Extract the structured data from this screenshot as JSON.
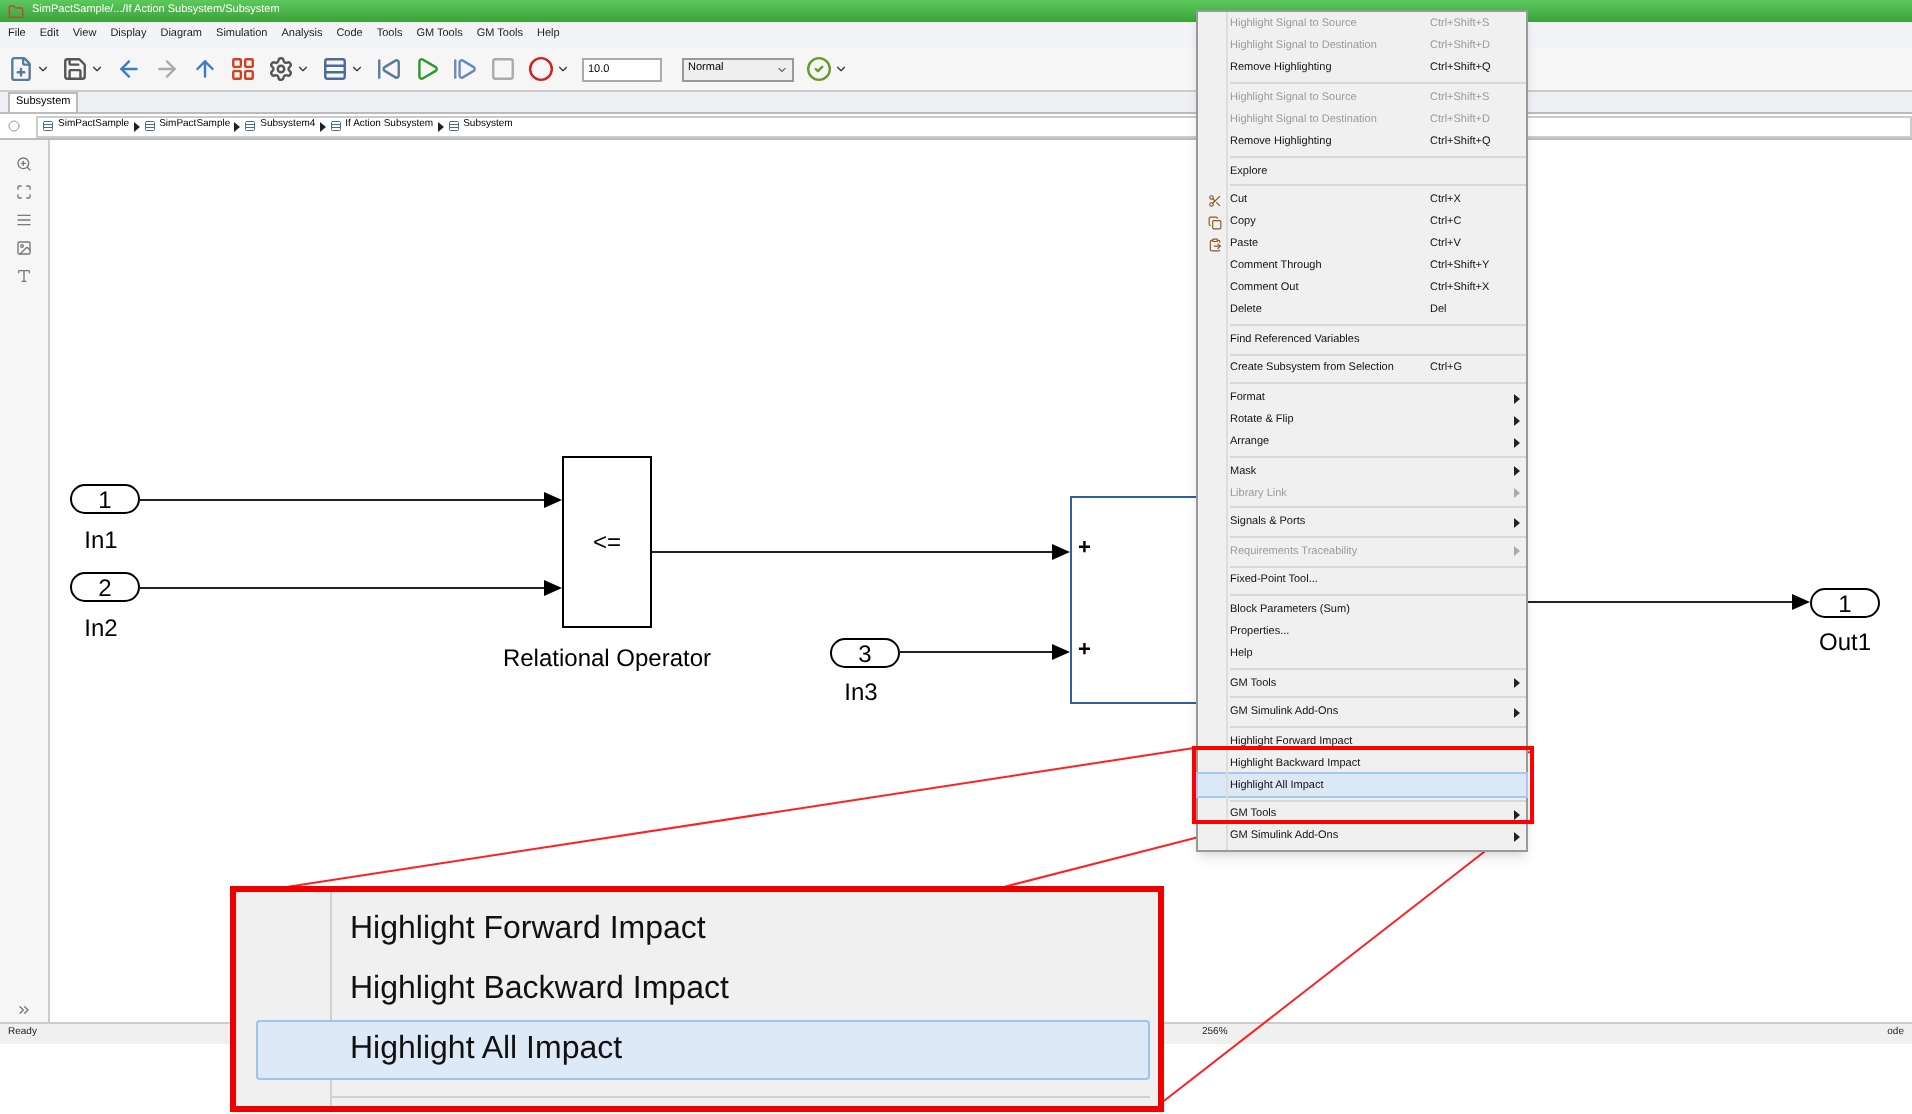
{
  "window": {
    "title": "SimPactSample/.../If Action Subsystem/Subsystem"
  },
  "menu_bar": [
    "File",
    "Edit",
    "View",
    "Display",
    "Diagram",
    "Simulation",
    "Analysis",
    "Code",
    "Tools",
    "GM Tools",
    "GM Tools",
    "Help"
  ],
  "toolbar": {
    "stop_time": "10.0",
    "sim_mode": "Normal"
  },
  "tabs": [
    {
      "label": "Subsystem",
      "selected": true
    }
  ],
  "breadcrumb": [
    "SimPactSample",
    "SimPactSample",
    "Subsystem4",
    "If Action Subsystem",
    "Subsystem"
  ],
  "diagram": {
    "blocks": [
      {
        "kind": "inport",
        "number": "1",
        "label": "In1"
      },
      {
        "kind": "inport",
        "number": "2",
        "label": "In2"
      },
      {
        "kind": "relational",
        "symbol": "<=",
        "label": "Relational Operator"
      },
      {
        "kind": "inport",
        "number": "3",
        "label": "In3"
      },
      {
        "kind": "sum",
        "signs": [
          "+",
          "+"
        ]
      },
      {
        "kind": "outport",
        "number": "1",
        "label": "Out1"
      }
    ]
  },
  "context_menu": [
    {
      "kind": "item",
      "label": "Highlight Signal to Source",
      "shortcut": "Ctrl+Shift+S",
      "disabled": true,
      "submenu": false,
      "selected": false
    },
    {
      "kind": "item",
      "label": "Highlight Signal to Destination",
      "shortcut": "Ctrl+Shift+D",
      "disabled": true,
      "submenu": false,
      "selected": false
    },
    {
      "kind": "item",
      "label": "Remove Highlighting",
      "shortcut": "Ctrl+Shift+Q",
      "disabled": false,
      "submenu": false,
      "selected": false
    },
    {
      "kind": "separator"
    },
    {
      "kind": "item",
      "label": "Highlight Signal to Source",
      "shortcut": "Ctrl+Shift+S",
      "disabled": true,
      "submenu": false,
      "selected": false
    },
    {
      "kind": "item",
      "label": "Highlight Signal to Destination",
      "shortcut": "Ctrl+Shift+D",
      "disabled": true,
      "submenu": false,
      "selected": false
    },
    {
      "kind": "item",
      "label": "Remove Highlighting",
      "shortcut": "Ctrl+Shift+Q",
      "disabled": false,
      "submenu": false,
      "selected": false
    },
    {
      "kind": "separator"
    },
    {
      "kind": "item",
      "label": "Explore",
      "disabled": false,
      "submenu": false,
      "selected": false
    },
    {
      "kind": "separator"
    },
    {
      "kind": "icon-item",
      "label": "Cut",
      "shortcut": "Ctrl+X",
      "disabled": false,
      "submenu": false,
      "selected": false
    },
    {
      "kind": "icon-item",
      "label": "Copy",
      "shortcut": "Ctrl+C",
      "disabled": false,
      "submenu": false,
      "selected": false
    },
    {
      "kind": "icon-item",
      "label": "Paste",
      "shortcut": "Ctrl+V",
      "disabled": false,
      "submenu": false,
      "selected": false
    },
    {
      "kind": "item",
      "label": "Comment Through",
      "shortcut": "Ctrl+Shift+Y",
      "disabled": false,
      "submenu": false,
      "selected": false
    },
    {
      "kind": "item",
      "label": "Comment Out",
      "shortcut": "Ctrl+Shift+X",
      "disabled": false,
      "submenu": false,
      "selected": false
    },
    {
      "kind": "item",
      "label": "Delete",
      "shortcut": "Del",
      "disabled": false,
      "submenu": false,
      "selected": false
    },
    {
      "kind": "separator"
    },
    {
      "kind": "item",
      "label": "Find Referenced Variables",
      "disabled": false,
      "submenu": false,
      "selected": false
    },
    {
      "kind": "separator"
    },
    {
      "kind": "item",
      "label": "Create Subsystem from Selection",
      "shortcut": "Ctrl+G",
      "disabled": false,
      "submenu": false,
      "selected": false
    },
    {
      "kind": "separator"
    },
    {
      "kind": "item",
      "label": "Format",
      "disabled": false,
      "submenu": true,
      "selected": false
    },
    {
      "kind": "item",
      "label": "Rotate & Flip",
      "disabled": false,
      "submenu": true,
      "selected": false
    },
    {
      "kind": "item",
      "label": "Arrange",
      "disabled": false,
      "submenu": true,
      "selected": false
    },
    {
      "kind": "separator"
    },
    {
      "kind": "item",
      "label": "Mask",
      "disabled": false,
      "submenu": true,
      "selected": false
    },
    {
      "kind": "item",
      "label": "Library Link",
      "disabled": true,
      "submenu": true,
      "selected": false
    },
    {
      "kind": "separator"
    },
    {
      "kind": "item",
      "label": "Signals & Ports",
      "disabled": false,
      "submenu": true,
      "selected": false
    },
    {
      "kind": "separator"
    },
    {
      "kind": "item",
      "label": "Requirements Traceability",
      "disabled": true,
      "submenu": true,
      "selected": false
    },
    {
      "kind": "separator"
    },
    {
      "kind": "item",
      "label": "Fixed-Point Tool...",
      "disabled": false,
      "submenu": false,
      "selected": false
    },
    {
      "kind": "separator"
    },
    {
      "kind": "item",
      "label": "Block Parameters (Sum)",
      "disabled": false,
      "submenu": false,
      "selected": false
    },
    {
      "kind": "item",
      "label": "Properties...",
      "disabled": false,
      "submenu": false,
      "selected": false
    },
    {
      "kind": "item",
      "label": "Help",
      "disabled": false,
      "submenu": false,
      "selected": false
    },
    {
      "kind": "separator"
    },
    {
      "kind": "item",
      "label": "GM Tools",
      "disabled": false,
      "submenu": true,
      "selected": false
    },
    {
      "kind": "separator"
    },
    {
      "kind": "item",
      "label": "GM Simulink Add-Ons",
      "disabled": false,
      "submenu": true,
      "selected": false
    },
    {
      "kind": "separator"
    },
    {
      "kind": "item",
      "label": "Highlight Forward Impact",
      "disabled": false,
      "submenu": false,
      "selected": false
    },
    {
      "kind": "item",
      "label": "Highlight Backward Impact",
      "disabled": false,
      "submenu": false,
      "selected": false
    },
    {
      "kind": "item",
      "label": "Highlight All Impact",
      "disabled": false,
      "submenu": false,
      "selected": true
    },
    {
      "kind": "separator"
    },
    {
      "kind": "item",
      "label": "GM Tools",
      "disabled": false,
      "submenu": true,
      "selected": false
    },
    {
      "kind": "item",
      "label": "GM Simulink Add-Ons",
      "disabled": false,
      "submenu": true,
      "selected": false
    }
  ],
  "callout": [
    {
      "label": "Highlight Forward Impact",
      "selected": false
    },
    {
      "label": "Highlight Backward Impact",
      "selected": false
    },
    {
      "label": "Highlight All Impact",
      "selected": true
    }
  ],
  "status_bar": {
    "status": "Ready",
    "zoom": "256%",
    "solver": "ode"
  }
}
